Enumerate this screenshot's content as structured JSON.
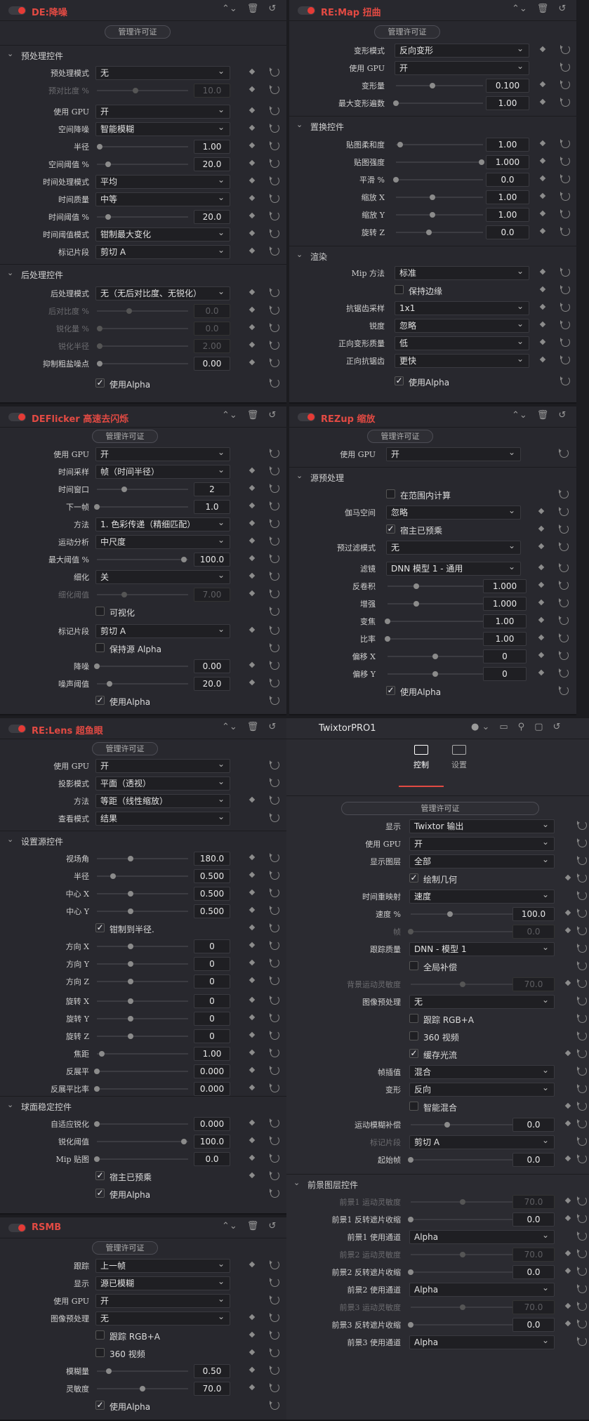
{
  "license_label": "管理许可证",
  "p1": {
    "title": "DE:降噪",
    "s1": "预处理控件",
    "s2": "后处理控件",
    "r_pre_mode": "预处理模式",
    "v_pre_mode": "无",
    "r_pre_ratio": "预对比度 %",
    "v_pre_ratio": "10.0",
    "r_gpu": "使用 GPU",
    "v_gpu": "开",
    "r_spatial": "空间降噪",
    "v_spatial": "智能模糊",
    "r_radius": "半径",
    "v_radius": "1.00",
    "r_spatial_th": "空间阈值 %",
    "v_spatial_th": "20.0",
    "r_time_mode": "时间处理模式",
    "v_time_mode": "平均",
    "r_time_q": "时间质量",
    "v_time_q": "中等",
    "r_time_th": "时间阈值 %",
    "v_time_th": "20.0",
    "r_time_thm": "时间阈值模式",
    "v_time_thm": "钳制最大变化",
    "r_mark": "标记片段",
    "v_mark": "剪切 A",
    "r_post_mode": "后处理模式",
    "v_post_mode": "无（无后对比度、无锐化）",
    "r_post_ratio": "后对比度 %",
    "v_post_ratio": "0.0",
    "r_sharp": "锐化量 %",
    "v_sharp": "0.0",
    "r_sharp_r": "锐化半径",
    "v_sharp_r": "2.00",
    "r_grain": "抑制粗盐噪点",
    "v_grain": "0.00",
    "alpha": "使用Alpha"
  },
  "p2": {
    "title": "RE:Map 扭曲",
    "r_warp_mode": "变形模式",
    "v_warp_mode": "反向变形",
    "r_gpu": "使用 GPU",
    "v_gpu": "开",
    "r_amount": "变形量",
    "v_amount": "0.100",
    "r_iter": "最大变形遍数",
    "v_iter": "1.00",
    "s1": "置换控件",
    "r_soft": "贴图柔和度",
    "v_soft": "1.00",
    "r_strength": "贴图强度",
    "v_strength": "1.000",
    "r_smooth": "平滑 %",
    "v_smooth": "0.0",
    "r_scalex": "缩放 X",
    "v_scalex": "1.00",
    "r_scaley": "缩放 Y",
    "v_scaley": "1.00",
    "r_rotz": "旋转 Z",
    "v_rotz": "0.0",
    "s2": "渲染",
    "r_mip": "Mip 方法",
    "v_mip": "标准",
    "keep_edge": "保持边缘",
    "r_aa": "抗锯齿采样",
    "v_aa": "1x1",
    "r_sharp": "锐度",
    "v_sharp": "忽略",
    "r_fq": "正向变形质量",
    "v_fq": "低",
    "r_faa": "正向抗锯齿",
    "v_faa": "更快",
    "alpha": "使用Alpha"
  },
  "p3": {
    "title": "DEFlicker 高速去闪烁",
    "r_gpu": "使用 GPU",
    "v_gpu": "开",
    "r_ts": "时间采样",
    "v_ts": "帧（时间半径）",
    "r_tw": "时间窗口",
    "v_tw": "2",
    "r_next": "下一帧",
    "v_next": "1.0",
    "r_method": "方法",
    "v_method": "1. 色彩传递（精细匹配）",
    "r_motion": "运动分析",
    "v_motion": "中尺度",
    "r_maxth": "最大阈值 %",
    "v_maxth": "100.0",
    "r_refine": "细化",
    "v_refine": "关",
    "r_refine_th": "细化阈值",
    "v_refine_th": "7.00",
    "visualize": "可视化",
    "r_mark": "标记片段",
    "v_mark": "剪切 A",
    "keep_alpha": "保持源 Alpha",
    "r_dn": "降噪",
    "v_dn": "0.00",
    "r_nth": "噪声阈值",
    "v_nth": "20.0",
    "alpha": "使用Alpha"
  },
  "p4": {
    "title": "REZup 缩放",
    "r_gpu": "使用 GPU",
    "v_gpu": "开",
    "s1": "源预处理",
    "in_range": "在范围内计算",
    "r_gamma": "伽马空间",
    "v_gamma": "忽略",
    "premult": "宿主已预乘",
    "r_prefilter": "预过滤模式",
    "v_prefilter": "无",
    "r_filter": "滤镜",
    "v_filter": "DNN 模型 1 - 通用",
    "r_deconv": "反卷积",
    "v_deconv": "1.000",
    "r_enh": "增强",
    "v_enh": "1.000",
    "r_zoom": "变焦",
    "v_zoom": "1.00",
    "r_ratio": "比率",
    "v_ratio": "1.00",
    "r_offx": "偏移 X",
    "v_offx": "0",
    "r_offy": "偏移 Y",
    "v_offy": "0",
    "alpha": "使用Alpha"
  },
  "p5": {
    "title": "RE:Lens 超鱼眼",
    "r_gpu": "使用 GPU",
    "v_gpu": "开",
    "r_proj": "投影模式",
    "v_proj": "平面（透视）",
    "r_method": "方法",
    "v_method": "等距（线性缩放）",
    "r_view": "查看模式",
    "v_view": "结果",
    "s1": "设置源控件",
    "r_fov": "视场角",
    "v_fov": "180.0",
    "r_radius": "半径",
    "v_radius": "0.500",
    "r_cx": "中心 X",
    "v_cx": "0.500",
    "r_cy": "中心 Y",
    "v_cy": "0.500",
    "clamp": "钳制到半径.",
    "r_dx": "方向 X",
    "v_dx": "0",
    "r_dy": "方向 Y",
    "v_dy": "0",
    "r_dz": "方向 Z",
    "v_dz": "0",
    "r_rx": "旋转 X",
    "v_rx": "0",
    "r_ry": "旋转 Y",
    "v_ry": "0",
    "r_rz": "旋转 Z",
    "v_rz": "0",
    "r_focal": "焦距",
    "v_focal": "1.00",
    "r_flat": "反展平",
    "v_flat": "0.000",
    "r_flat2": "反展平比率",
    "v_flat2": "0.000",
    "s2": "球面稳定控件",
    "r_asharp": "自适应锐化",
    "v_asharp": "0.000",
    "r_sth": "锐化阈值",
    "v_sth": "100.0",
    "r_mip": "Mip 贴图",
    "v_mip": "0.0",
    "premult": "宿主已预乘",
    "alpha": "使用Alpha"
  },
  "p6": {
    "title": "RSMB",
    "r_track": "跟踪",
    "v_track": "上一帧",
    "r_show": "显示",
    "v_show": "源已模糊",
    "r_gpu": "使用 GPU",
    "v_gpu": "开",
    "r_pre": "图像预处理",
    "v_pre": "无",
    "rgba": "跟踪 RGB+A",
    "v360": "360 视频",
    "r_blur": "模糊量",
    "v_blur": "0.50",
    "r_sens": "灵敏度",
    "v_sens": "70.0",
    "alpha": "使用Alpha"
  },
  "p7": {
    "title": "TwixtorPRO1",
    "tab_ctrl": "控制",
    "tab_set": "设置",
    "r_show": "显示",
    "v_show": "Twixtor 输出",
    "r_gpu": "使用 GPU",
    "v_gpu": "开",
    "r_layer": "显示图层",
    "v_layer": "全部",
    "draw_geo": "绘制几何",
    "r_remap": "时间重映射",
    "v_remap": "速度",
    "r_speed": "速度 %",
    "v_speed": "100.0",
    "r_frame": "帧",
    "v_frame": "0.0",
    "r_tq": "跟踪质量",
    "v_tq": "DNN - 模型 1",
    "global": "全局补偿",
    "r_bgsens": "背景运动灵敏度",
    "v_bgsens": "70.0",
    "r_pre": "图像预处理",
    "v_pre": "无",
    "rgba": "跟踪 RGB+A",
    "v360": "360 视频",
    "cache": "缓存光流",
    "r_interp": "帧插值",
    "v_interp": "混合",
    "r_warp": "变形",
    "v_warp": "反向",
    "smart": "智能混合",
    "r_mbc": "运动模糊补偿",
    "v_mbc": "0.0",
    "r_mark": "标记片段",
    "v_mark": "剪切 A",
    "r_start": "起始帧",
    "v_start": "0.0",
    "s1": "前景图层控件",
    "r_f1s": "前景1 运动灵敏度",
    "v_f1s": "70.0",
    "r_f1m": "前景1 反转遮片收缩",
    "v_f1m": "0.0",
    "r_f1c": "前景1 使用通道",
    "v_f1c": "Alpha",
    "r_f2s": "前景2 运动灵敏度",
    "v_f2s": "70.0",
    "r_f2m": "前景2 反转遮片收缩",
    "v_f2m": "0.0",
    "r_f2c": "前景2 使用通道",
    "v_f2c": "Alpha",
    "r_f3s": "前景3 运动灵敏度",
    "v_f3s": "70.0",
    "r_f3m": "前景3 反转遮片收缩",
    "v_f3m": "0.0",
    "r_f3c": "前景3 使用通道",
    "v_f3c": "Alpha"
  },
  "colors": {
    "accent": "#e24a43",
    "panel": "#28282e",
    "field": "#1f1f23"
  },
  "icons": [
    "power-toggle-icon",
    "chevron-updown-icon",
    "trash-icon",
    "reset-icon",
    "keyframe-diamond-icon",
    "checkbox-icon",
    "dropdown-chevron-icon",
    "control-tab-icon",
    "settings-tab-icon"
  ]
}
